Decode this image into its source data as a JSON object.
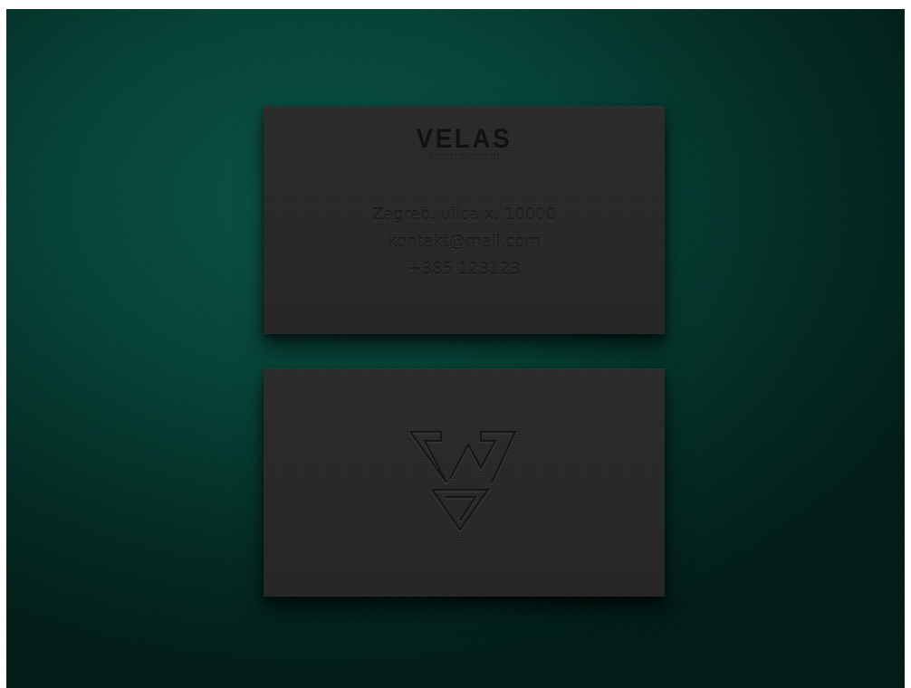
{
  "scene": {
    "background_color": "#064236",
    "card_color": "#282827"
  },
  "card_front": {
    "brand": "VELAS",
    "tagline": "entertainment",
    "contact": {
      "address": "Zagreb, ulica x, 10000",
      "email": "kontakt@mail.com",
      "phone": "+385 123123"
    }
  },
  "card_back": {
    "logo_icon": "velas-v-monogram-icon"
  }
}
